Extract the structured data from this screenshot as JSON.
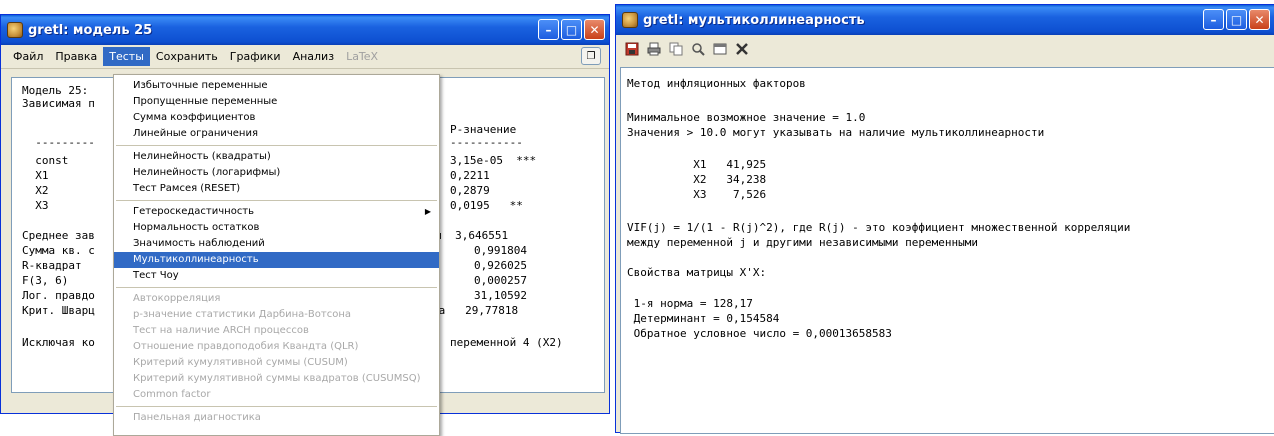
{
  "left_window": {
    "title": "gretl: модель 25",
    "menu": {
      "file": "Файл",
      "edit": "Правка",
      "tests": "Тесты",
      "save": "Сохранить",
      "graphs": "Графики",
      "analysis": "Анализ",
      "latex": "LaTeX"
    },
    "text_lines": [
      "Модель 25:",
      "Зависимая п",
      "P-значение",
      "-----------",
      "  ---------",
      "  const",
      "3,15e-05  ***",
      "  X1",
      "0,2211",
      "  X2",
      "0,2879",
      "  X3",
      "0,0195   **",
      "Среднее зав",
      "мен  3,646551",
      "Сумма кв. с",
      "0,991804",
      "R-квадрат",
      "0,926025",
      "F(3, 6)",
      "0,000257",
      "Лог. правдо",
      "31,10592",
      "Крит. Шварц",
      "на   29,77818",
      "Исключая ко",
      "переменной 4 (X2)"
    ]
  },
  "tests_menu": {
    "items": [
      "Избыточные переменные",
      "Пропущенные переменные",
      "Сумма коэффициентов",
      "Линейные ограничения",
      "Нелинейность (квадраты)",
      "Нелинейность (логарифмы)",
      "Тест Рамсея (RESET)",
      "Гетероскедастичность",
      "Нормальность остатков",
      "Значимость наблюдений",
      "Мультиколлинеарность",
      "Тест Чоу",
      "Автокорреляция",
      "p-значение статистики Дарбина-Вотсона",
      "Тест на наличие ARCH процессов",
      "Отношение правдоподобия Квандта (QLR)",
      "Критерий кумулятивной суммы (CUSUM)",
      "Критерий кумулятивной суммы квадратов (CUSUMSQ)",
      "Common factor",
      "Панельная диагностика"
    ]
  },
  "right_window": {
    "title": "gretl: мультиколлинеарность",
    "toolbar_icons": [
      "save-icon",
      "print-icon",
      "copy-icon",
      "find-icon",
      "window-icon",
      "close-icon"
    ],
    "text_lines": [
      "Метод инфляционных факторов",
      "",
      "Минимальное возможное значение = 1.0",
      "Значения > 10.0 могут указывать на наличие мультиколлинеарности",
      "",
      "          X1   41,925",
      "          X2   34,238",
      "          X3    7,526",
      "",
      "VIF(j) = 1/(1 - R(j)^2), где R(j) - это коэффициент множественной корреляции",
      "между переменной j и другими независимыми переменными",
      "",
      "Свойства матрицы X'X:",
      "",
      " 1-я норма = 128,17",
      " Детерминант = 0,154584",
      " Обратное условное число = 0,00013658583"
    ]
  },
  "colors": {
    "titlebar": "#1a62e0",
    "highlight": "#316ac5",
    "window_bg": "#ece9d8"
  }
}
